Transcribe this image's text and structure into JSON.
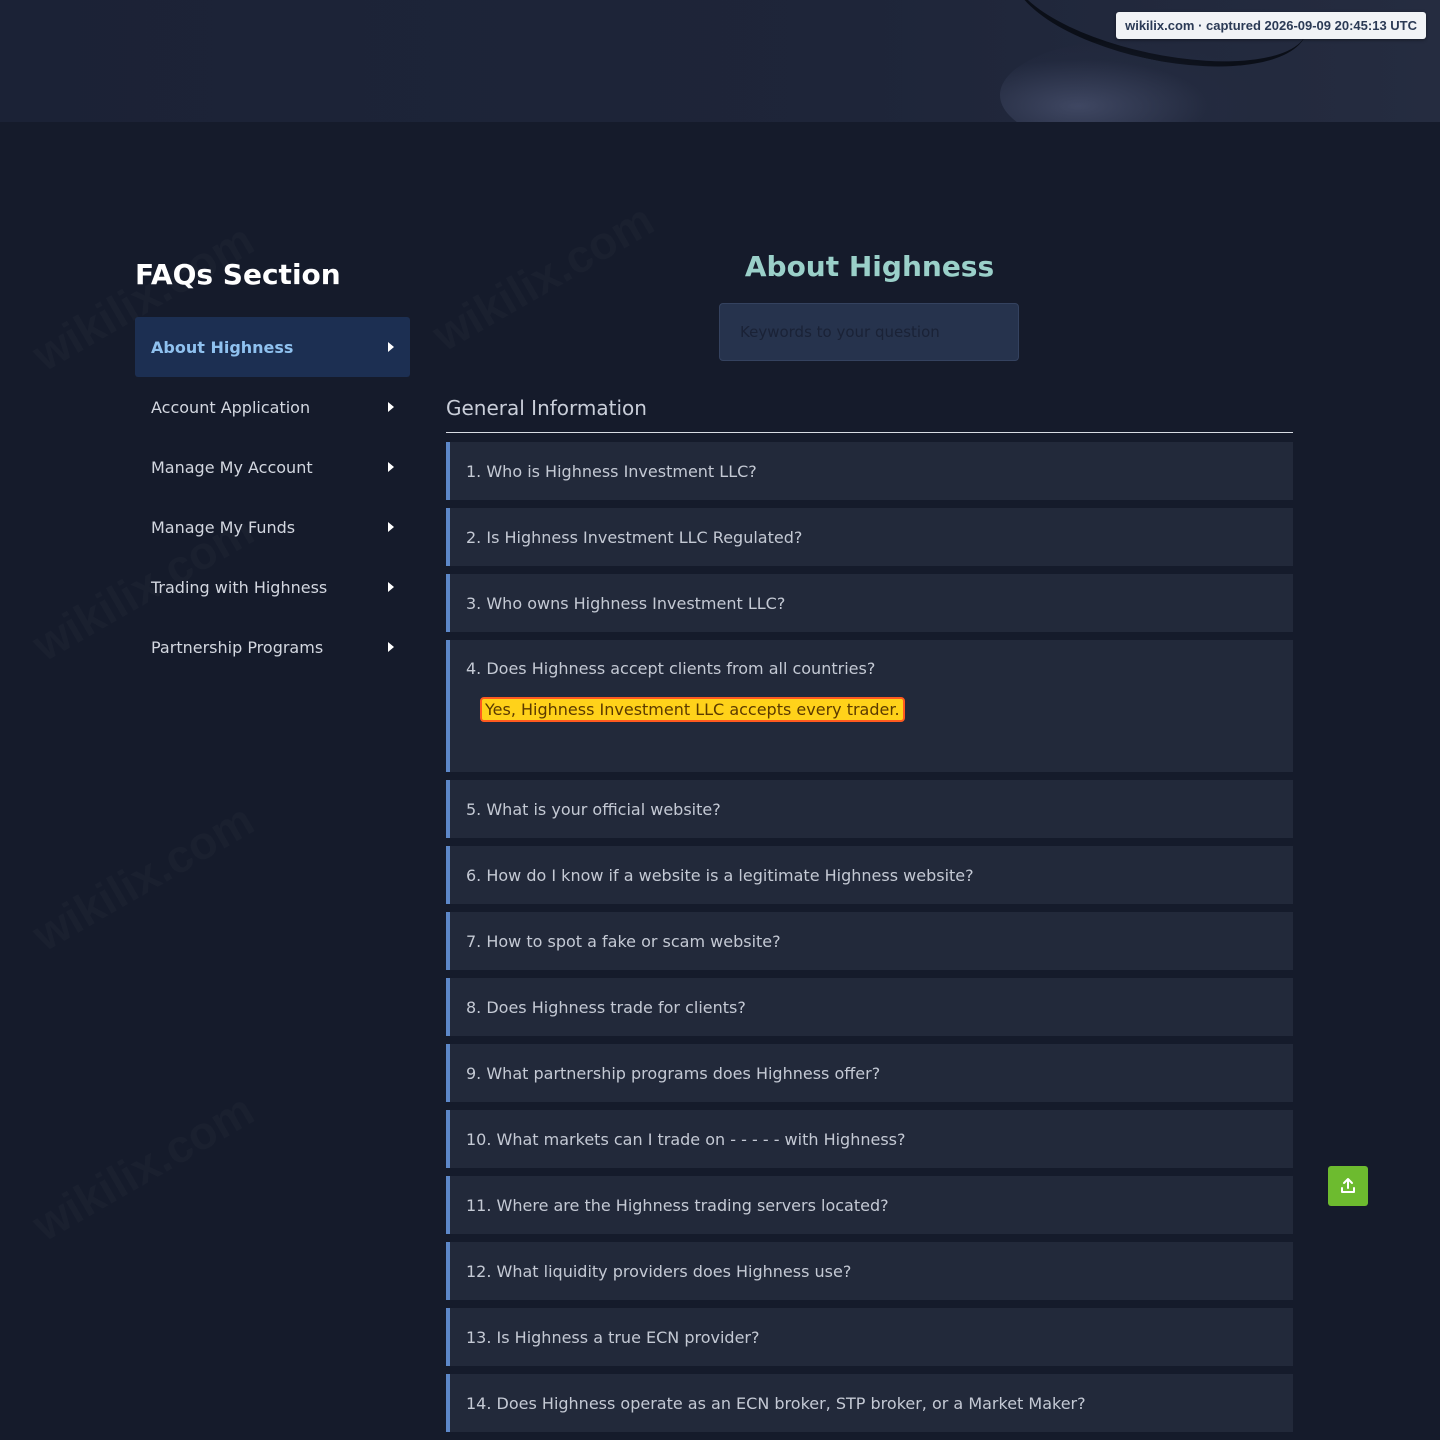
{
  "capture_badge": "wikilix.com · captured 2026-09-09 20:45:13 UTC",
  "sidebar": {
    "title": "FAQs Section",
    "items": [
      {
        "label": "About Highness"
      },
      {
        "label": "Account Application"
      },
      {
        "label": "Manage My Account"
      },
      {
        "label": "Manage My Funds"
      },
      {
        "label": "Trading with Highness"
      },
      {
        "label": "Partnership Programs"
      }
    ]
  },
  "main": {
    "title": "About Highness",
    "search": {
      "placeholder": "Keywords to your question"
    },
    "section_heading": "General Information",
    "faqs": [
      {
        "question": "1. Who is Highness Investment LLC?"
      },
      {
        "question": "2. Is Highness Investment LLC Regulated?"
      },
      {
        "question": "3. Who owns Highness Investment LLC?"
      },
      {
        "question": "4. Does Highness accept clients from all countries?",
        "answer": "Yes, Highness Investment LLC accepts every trader."
      },
      {
        "question": "5. What is your official website?"
      },
      {
        "question": "6. How do I know if a website is a legitimate Highness website?"
      },
      {
        "question": "7. How to spot a fake or scam website?"
      },
      {
        "question": "8. Does Highness trade for clients?"
      },
      {
        "question": "9. What partnership programs does Highness offer?"
      },
      {
        "question": "10. What markets can I trade on - - - - - with Highness?"
      },
      {
        "question": "11. Where are the Highness trading servers located?"
      },
      {
        "question": "12. What liquidity providers does Highness use?"
      },
      {
        "question": "13. Is Highness a true ECN provider?"
      },
      {
        "question": "14. Does Highness operate as an ECN broker, STP broker, or a Market Maker?"
      }
    ]
  },
  "icons": {
    "submenu_arrow": "caret-right-icon",
    "scroll_top": "upload-arrow-icon"
  },
  "colors": {
    "accent_active": "#8fc1ef",
    "title_teal": "#9ad0c9",
    "faq_border": "#5d88c9",
    "highlight_bg": "#ffd21a",
    "highlight_border": "#ff5a1f",
    "scroll_button": "#6dbb2f"
  }
}
